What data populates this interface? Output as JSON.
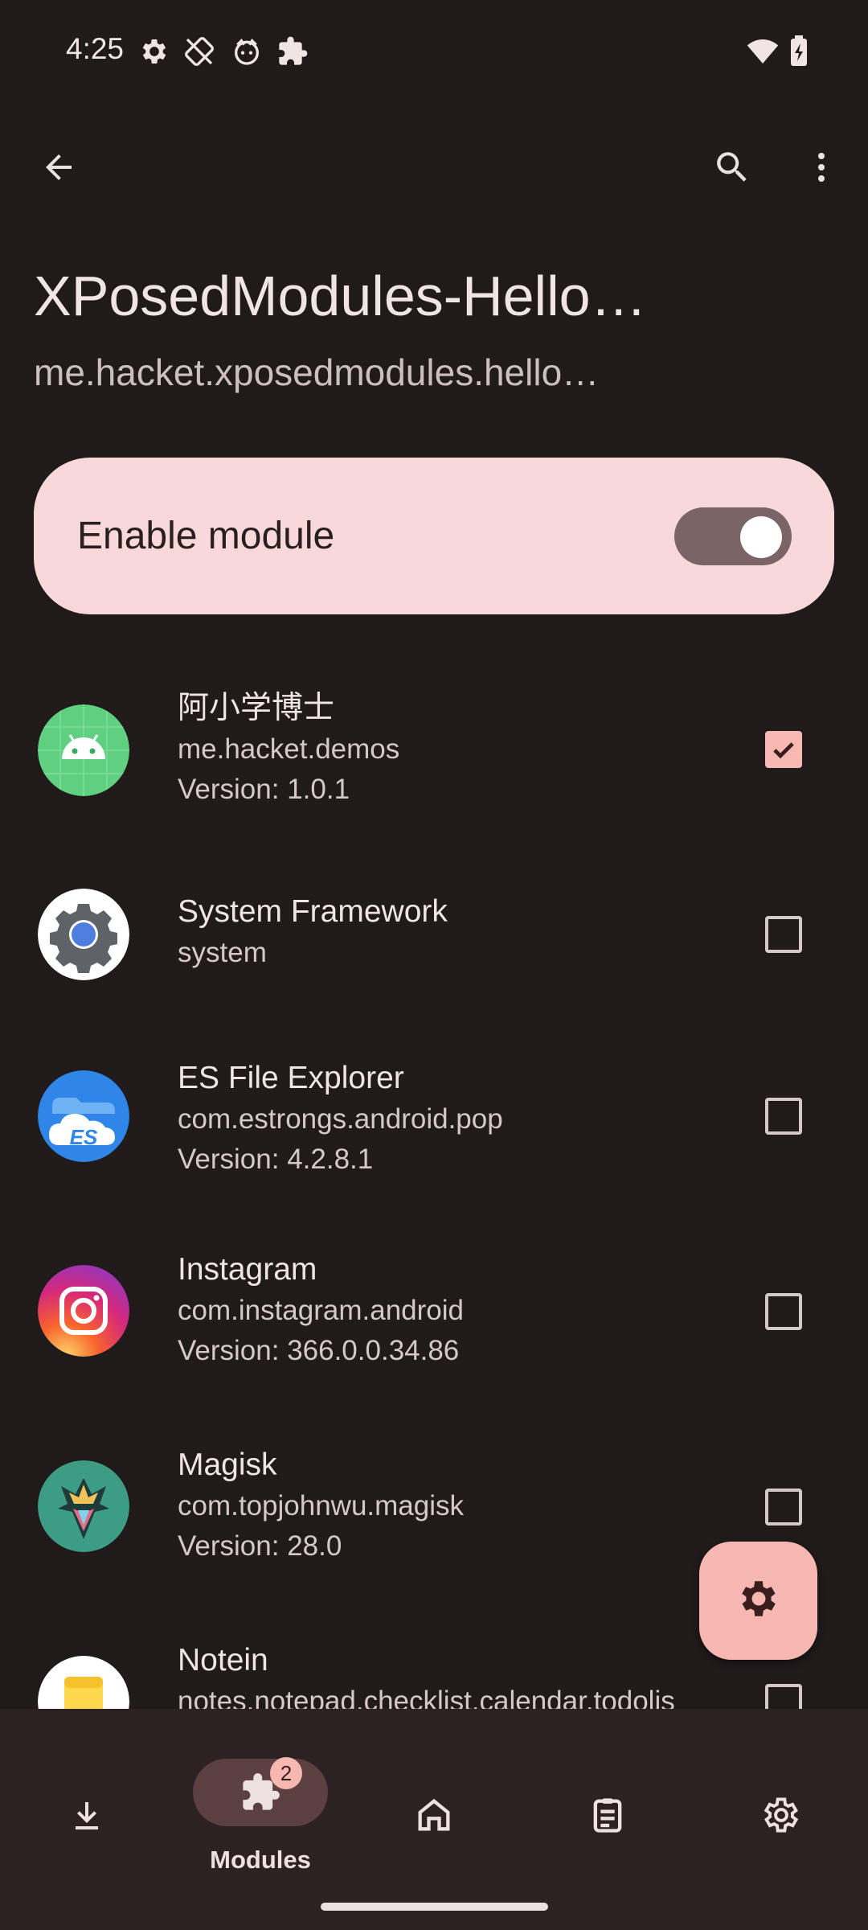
{
  "status_bar": {
    "time": "4:25",
    "left_icons": [
      "settings-gear-icon",
      "no-touch-icon",
      "fox-face-icon",
      "puzzle-icon"
    ],
    "right_icons": [
      "wifi-icon",
      "battery-charging-icon"
    ]
  },
  "app_bar": {
    "back_icon": "arrow-back-icon",
    "search_icon": "search-icon",
    "more_icon": "more-vert-icon"
  },
  "header": {
    "title": "XPosedModules-Hello…",
    "subtitle": "me.hacket.xposedmodules.hello…"
  },
  "enable_card": {
    "label": "Enable module",
    "enabled": true
  },
  "apps": [
    {
      "name": "阿小学博士",
      "package": "me.hacket.demos",
      "version": "Version: 1.0.1",
      "checked": true,
      "icon": "android-app-icon"
    },
    {
      "name": "System Framework",
      "package": "system",
      "version": "",
      "checked": false,
      "icon": "system-settings-icon"
    },
    {
      "name": "ES File Explorer",
      "package": "com.estrongs.android.pop",
      "version": "Version: 4.2.8.1",
      "checked": false,
      "icon": "es-file-explorer-icon"
    },
    {
      "name": "Instagram",
      "package": "com.instagram.android",
      "version": "Version: 366.0.0.34.86",
      "checked": false,
      "icon": "instagram-icon"
    },
    {
      "name": "Magisk",
      "package": "com.topjohnwu.magisk",
      "version": "Version: 28.0",
      "checked": false,
      "icon": "magisk-icon"
    },
    {
      "name": "Notein",
      "package": "notes.notepad.checklist.calendar.todolis",
      "version": "",
      "checked": false,
      "icon": "notein-icon"
    }
  ],
  "fab": {
    "icon": "settings-gear-icon"
  },
  "bottom_nav": {
    "items": [
      {
        "icon": "download-icon",
        "label": ""
      },
      {
        "icon": "puzzle-icon",
        "label": "Modules",
        "badge": "2",
        "selected": true
      },
      {
        "icon": "home-icon",
        "label": ""
      },
      {
        "icon": "logs-clipboard-icon",
        "label": ""
      },
      {
        "icon": "settings-gear-icon",
        "label": ""
      }
    ]
  },
  "colors": {
    "background": "#201a1b",
    "card": "#f8d8d8",
    "accent": "#f6b8b1",
    "nav_bar": "#2c2224",
    "nav_pill": "#5b3f41"
  }
}
